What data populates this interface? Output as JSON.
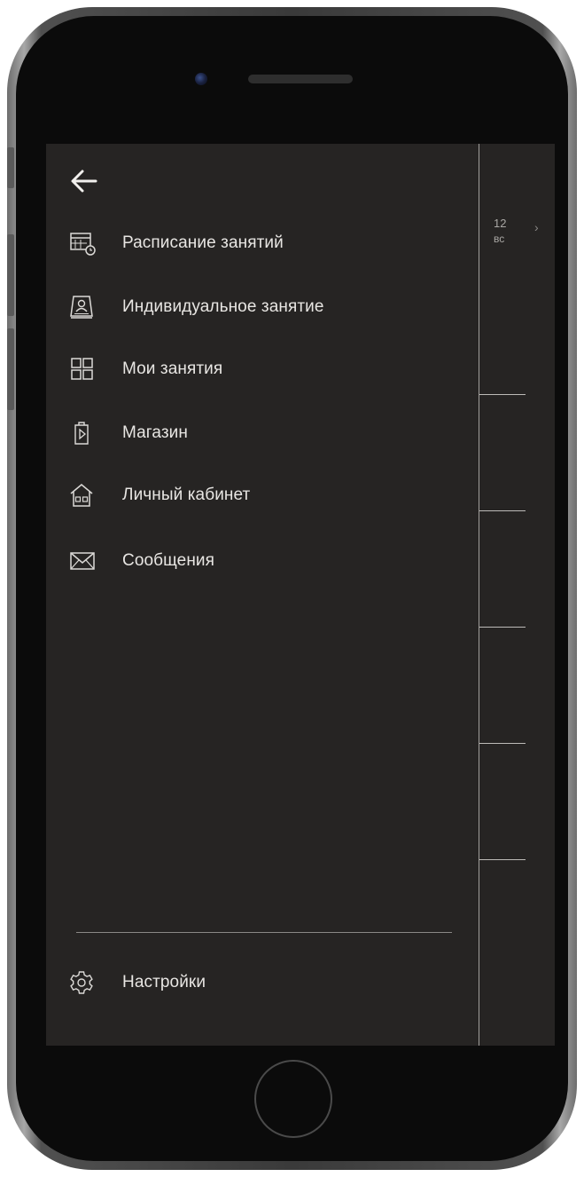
{
  "drawer": {
    "items": [
      {
        "label": "Расписание занятий",
        "icon": "calendar-clock-icon"
      },
      {
        "label": "Индивидуальное занятие",
        "icon": "person-card-icon"
      },
      {
        "label": "Мои занятия",
        "icon": "grid-icon"
      },
      {
        "label": "Магазин",
        "icon": "shopping-bag-icon"
      },
      {
        "label": "Личный кабинет",
        "icon": "house-icon"
      },
      {
        "label": "Сообщения",
        "icon": "envelope-icon"
      }
    ],
    "settings": {
      "label": "Настройки",
      "icon": "gear-icon"
    }
  },
  "calendar": {
    "day_number": "12",
    "day_name": "вс"
  },
  "colors": {
    "background": "#262423",
    "text": "#e8e6e3",
    "muted": "#a9a7a4"
  }
}
